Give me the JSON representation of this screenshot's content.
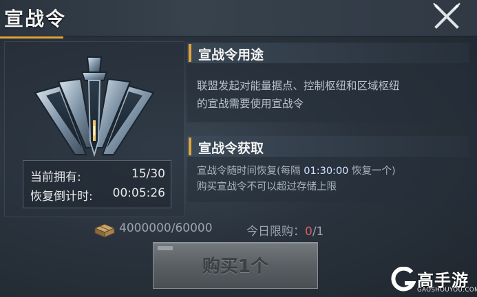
{
  "header": {
    "title": "宣战令"
  },
  "stock": {
    "owned_label": "当前拥有:",
    "owned_value": "15/30",
    "timer_label": "恢复倒计时:",
    "timer_value": "00:05:26"
  },
  "usage": {
    "title": "宣战令用途",
    "line1": "联盟发起对能量据点、控制枢纽和区域枢纽",
    "line2": "的宣战需要使用宣战令"
  },
  "acquire": {
    "title": "宣战令获取",
    "line1_prefix": "宣战令随时间恢复(每隔 ",
    "interval": "01:30:00",
    "line1_suffix": " 恢复一个)",
    "line2": "购买宣战令不可以超过存储上限"
  },
  "purchase": {
    "cost": "4000000/60000",
    "limit_label": "今日限购：",
    "limit_used": "0",
    "limit_total": "/1",
    "buy_label": "购买1个"
  },
  "watermark": {
    "brand": "高手游",
    "site": "GAOSHOUYOU.COM"
  },
  "colors": {
    "accent": "#e3a53c",
    "limit_used": "#e05a6a"
  },
  "icons": {
    "close": "close-icon",
    "emblem": "war-emblem-icon",
    "cost": "resource-crate-icon",
    "logo": "gaoshouyou-logo-icon"
  }
}
